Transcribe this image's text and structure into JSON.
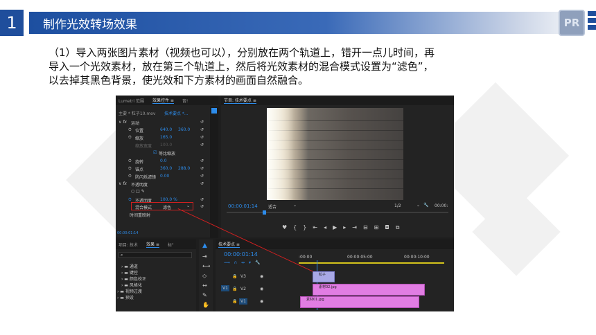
{
  "slide": {
    "number": "1",
    "title": "制作光效转场效果",
    "logo": "PR",
    "description": [
      "（1）导入两张图片素材（视频也可以），分别放在两个轨道上，错开一点儿时间，再",
      "导入一个光效素材，放在第三个轨道上，然后将光效素材的混合模式设置为“滤色”，",
      "以去掉其黑色背景，使光效和下方素材的画面自然融合。"
    ]
  },
  "premiere": {
    "effect_controls": {
      "tabs": [
        "Lumetri 范围",
        "效果控件 ≡",
        "音!"
      ],
      "source_label": "主要 * 粒子10.mov",
      "sequence_label": "技术要点 *...",
      "motion": "运动",
      "position_label": "位置",
      "position_x": "640.0",
      "position_y": "360.0",
      "scale_label": "缩放",
      "scale_value": "165.0",
      "scale_width_label": "缩放宽度",
      "scale_width_value": "100.0",
      "uniform_scale": "等比缩放",
      "rotation_label": "旋转",
      "rotation_value": "0.0",
      "anchor_label": "锚点",
      "anchor_x": "360.0",
      "anchor_y": "288.0",
      "antiflicker_label": "防闪烁滤镜",
      "antiflicker_value": "0.00",
      "opacity_section": "不透明度",
      "opacity_label": "不透明度",
      "opacity_value": "100.0 %",
      "blend_mode_label": "混合模式",
      "blend_mode_value": "滤色",
      "time_remap": "时间重映射",
      "timecode": "00:00:01:14"
    },
    "program_monitor": {
      "title": "节目: 技术要点 ≡",
      "timecode": "00:00:01:14",
      "mode": "适合",
      "resolution": "1/2",
      "end_timecode": "00:00:"
    },
    "effects_panel": {
      "tabs": [
        "项目: 技术",
        "效果 ≡",
        "标\""
      ],
      "items": [
        "通道",
        "键控",
        "颜色校正",
        "风格化",
        "视频过渡",
        "预设"
      ]
    },
    "timeline": {
      "title": "技术要点 ≡",
      "timecode": "00:00:01:14",
      "ruler": [
        ":00:00",
        "00:00:05:00",
        "00:00:10:00"
      ],
      "tracks": [
        "V3",
        "V2",
        "V1"
      ],
      "source_v": "V1",
      "clips": [
        {
          "label": "粒子",
          "track": "V3"
        },
        {
          "label": "素材02.jpg",
          "track": "V2"
        },
        {
          "label": "素材01.jpg",
          "track": "V1"
        }
      ]
    }
  }
}
